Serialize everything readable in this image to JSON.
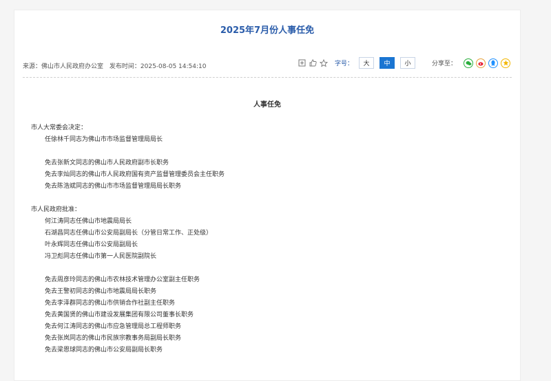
{
  "article": {
    "title": "2025年7月份人事任免",
    "source": "来源：佛山市人民政府办公室",
    "published": "发布时间：2025-08-05 14:54:10",
    "font_size_label": "字号：",
    "font_sizes": [
      "大",
      "中",
      "小"
    ],
    "selected_font_size": "中",
    "share_label": "分享至：",
    "heading": "人事任免"
  },
  "content": {
    "s1_title": "市人大常委会决定：",
    "s1_item1": "任徐林千同志为佛山市市场监督管理局局长",
    "s1_item2": "免去张新文同志的佛山市人民政府副市长职务",
    "s1_item3": "免去李灿同志的佛山市人民政府国有资产监督管理委员会主任职务",
    "s1_item4": "免去陈浩斌同志的佛山市市场监督管理局局长职务",
    "s2_title": "市人民政府批准：",
    "s2_item1": "何江涛同志任佛山市地震局局长",
    "s2_item2": "石湖昌同志任佛山市公安局副局长（分管日常工作、正处级）",
    "s2_item3": "叶永辉同志任佛山市公安局副局长",
    "s2_item4": "冯卫彪同志任佛山市第一人民医院副院长",
    "s2_item5": "免去周彦玲同志的佛山市农林技术管理办公室副主任职务",
    "s2_item6": "免去王警初同志的佛山市地震局局长职务",
    "s2_item7": "免去李泽群同志的佛山市供销合作社副主任职务",
    "s2_item8": "免去黄国贤的佛山市建设发展集团有限公司董事长职务",
    "s2_item9": "免去何江涛同志的佛山市应急管理局总工程师职务",
    "s2_item10": "免去张岚同志的佛山市民族宗教事务局副局长职务",
    "s2_item11": "免去梁恩球同志的佛山市公安局副局长职务"
  }
}
